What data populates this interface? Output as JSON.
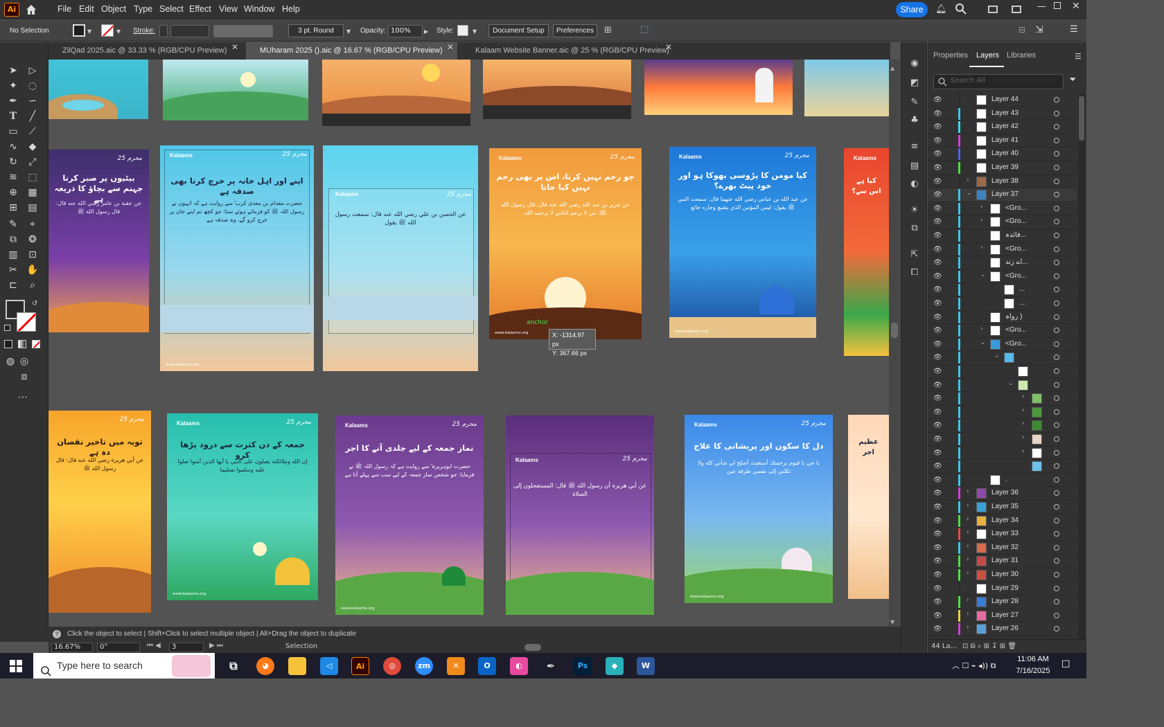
{
  "menubar": {
    "app_logo": "Ai",
    "items": [
      "File",
      "Edit",
      "Object",
      "Type",
      "Select",
      "Effect",
      "View",
      "Window",
      "Help"
    ],
    "share_label": "Share"
  },
  "control_bar": {
    "selection": "No Selection",
    "stroke_label": "Stroke:",
    "brush": "3 pt. Round",
    "opacity_label": "Opacity:",
    "opacity_value": "100%",
    "style_label": "Style:",
    "document_setup": "Document Setup",
    "preferences": "Preferences"
  },
  "tabs": [
    {
      "label": "ZilQad 2025.aic @ 33.33 % (RGB/CPU Preview)"
    },
    {
      "label": "MUharam 2025 ().aic @ 16.67 % (RGB/CPU Preview)"
    },
    {
      "label": "Kalaam Website Banner.aic @ 25 % (RGB/CPU Preview)"
    }
  ],
  "canvas": {
    "tooltip_x": "X: -1314.97 px",
    "tooltip_y": "Y: 367.66 px",
    "anchor_label": "anchor",
    "posters": {
      "brand": "Kalaams",
      "badge": "محرم 25",
      "website": "www.kalaams.org",
      "p_purple_title": "بیٹیوں پر صبر کرنا جہنم سے بچاؤ کا ذریعہ ہے",
      "p_cream_title": "اپنے اور اہل خانہ پر خرچ کرنا بھی صدقہ ہے",
      "p_orange_title": "جو رحم نہیں کرتا، اس پر بھی رحم نہیں کیا جاتا",
      "p_blue_title": "کیا مومن کا پڑوسی بھوکا ہو اور خود پیٹ بھرے؟",
      "p_red_title": "کیا ہے اس سے؟",
      "p_yellow_title": "توبہ میں تاخیر نقصان دہ ہے",
      "p_teal_title": "جمعہ کے دن کثرت سے درود پڑھا کرو",
      "p_purple2_title": "نماز جمعہ کے لیے جلدی آنے کا اجر",
      "p_sky_title": "دل کا سکون اور پریشانی کا علاج",
      "p_peach_title": "عظیم اجر"
    }
  },
  "status": {
    "hint": "Click the object to select  |  Shift+Click to select multiple object  |  Alt+Drag the object to duplicate",
    "zoom": "16.67%",
    "rotation": "0°",
    "artboard": "3",
    "mode": "Selection"
  },
  "panel": {
    "tabs": [
      "Properties",
      "Layers",
      "Libraries"
    ],
    "active_tab": "Layers",
    "search_placeholder": "Search All",
    "layers": [
      {
        "name": "Layer 44",
        "color": "#2b2b2b",
        "thumb": "#ffffff",
        "indent": 0,
        "tri": ""
      },
      {
        "name": "Layer 43",
        "color": "#3ec6e8",
        "thumb": "#ffffff",
        "indent": 0,
        "tri": ""
      },
      {
        "name": "Layer 42",
        "color": "#39d7e8",
        "thumb": "#ffffff",
        "indent": 0,
        "tri": ""
      },
      {
        "name": "Layer 41",
        "color": "#d43ed9",
        "thumb": "#ffffff",
        "indent": 0,
        "tri": ""
      },
      {
        "name": "Layer 40",
        "color": "#4b62e8",
        "thumb": "#ffffff",
        "indent": 0,
        "tri": ""
      },
      {
        "name": "Layer 39",
        "color": "#4ede42",
        "thumb": "#ffffff",
        "indent": 0,
        "tri": ""
      },
      {
        "name": "Layer 38",
        "color": "#2b2b2b",
        "thumb": "#9b6a4a",
        "indent": 0,
        "tri": "›"
      },
      {
        "name": "Layer 37",
        "color": "#3ec6e8",
        "thumb": "#3b82c4",
        "indent": 0,
        "tri": "⌄",
        "sel": true
      },
      {
        "name": "<Gro...",
        "color": "#3ec6e8",
        "thumb": "#ffffff",
        "indent": 1,
        "tri": "›"
      },
      {
        "name": "<Gro...",
        "color": "#3ec6e8",
        "thumb": "#ffffff",
        "indent": 1,
        "tri": "›"
      },
      {
        "name": "فائدہ...",
        "color": "#3ec6e8",
        "thumb": "#ffffff",
        "indent": 1,
        "tri": ""
      },
      {
        "name": "<Gro...",
        "color": "#3ec6e8",
        "thumb": "#ffffff",
        "indent": 1,
        "tri": "›"
      },
      {
        "name": "اے زند...",
        "color": "#3ec6e8",
        "thumb": "#ffffff",
        "indent": 1,
        "tri": ""
      },
      {
        "name": "<Gro...",
        "color": "#3ec6e8",
        "thumb": "#ffffff",
        "indent": 1,
        "tri": "⌄"
      },
      {
        "name": "...",
        "color": "#3ec6e8",
        "thumb": "#ffffff",
        "indent": 2,
        "tri": ""
      },
      {
        "name": "...",
        "color": "#3ec6e8",
        "thumb": "#ffffff",
        "indent": 2,
        "tri": ""
      },
      {
        "name": "رواہ )",
        "color": "#3ec6e8",
        "thumb": "#ffffff",
        "indent": 1,
        "tri": ""
      },
      {
        "name": "<Gro...",
        "color": "#3ec6e8",
        "thumb": "#ffffff",
        "indent": 1,
        "tri": "›"
      },
      {
        "name": "<Gro...",
        "color": "#3ec6e8",
        "thumb": "#3b9ad9",
        "indent": 1,
        "tri": "⌄"
      },
      {
        "name": "",
        "color": "#3ec6e8",
        "thumb": "#5ab8e8",
        "indent": 2,
        "tri": "⌄"
      },
      {
        "name": "",
        "color": "#3ec6e8",
        "thumb": "#ffffff",
        "indent": 3,
        "tri": ""
      },
      {
        "name": "",
        "color": "#3ec6e8",
        "thumb": "#cfe8b0",
        "indent": 3,
        "tri": "⌄"
      },
      {
        "name": "",
        "color": "#3ec6e8",
        "thumb": "#7fbf6a",
        "indent": 4,
        "tri": "›"
      },
      {
        "name": "",
        "color": "#3ec6e8",
        "thumb": "#4c9a3c",
        "indent": 4,
        "tri": "›"
      },
      {
        "name": "",
        "color": "#3ec6e8",
        "thumb": "#3f8a35",
        "indent": 4,
        "tri": "›"
      },
      {
        "name": "",
        "color": "#3ec6e8",
        "thumb": "#e8d4c8",
        "indent": 4,
        "tri": "›"
      },
      {
        "name": "",
        "color": "#3ec6e8",
        "thumb": "#ffffff",
        "indent": 4,
        "tri": "›"
      },
      {
        "name": "",
        "color": "#3ec6e8",
        "thumb": "#6fc0ea",
        "indent": 4,
        "tri": ""
      },
      {
        "name": ".",
        "color": "#3ec6e8",
        "thumb": "#ffffff",
        "indent": 1,
        "tri": ""
      },
      {
        "name": "Layer 36",
        "color": "#d43ed9",
        "thumb": "#8e4aa8",
        "indent": 0,
        "tri": "›"
      },
      {
        "name": "Layer 35",
        "color": "#3ec6e8",
        "thumb": "#3aa0d8",
        "indent": 0,
        "tri": "›"
      },
      {
        "name": "Layer 34",
        "color": "#4ede42",
        "thumb": "#e8b040",
        "indent": 0,
        "tri": "›"
      },
      {
        "name": "Layer 33",
        "color": "#e84b4b",
        "thumb": "#ffffff",
        "indent": 0,
        "tri": "›"
      },
      {
        "name": "Layer 32",
        "color": "#3ec6e8",
        "thumb": "#d66a4a",
        "indent": 0,
        "tri": "›"
      },
      {
        "name": "Layer 31",
        "color": "#4ede42",
        "thumb": "#c44a4a",
        "indent": 0,
        "tri": "›"
      },
      {
        "name": "Layer 30",
        "color": "#4ede42",
        "thumb": "#c85040",
        "indent": 0,
        "tri": "›"
      },
      {
        "name": "Layer 29",
        "color": "#2b2b2b",
        "thumb": "#ffffff",
        "indent": 0,
        "tri": ""
      },
      {
        "name": "Layer 28",
        "color": "#4ede42",
        "thumb": "#3a7bd5",
        "indent": 0,
        "tri": "›"
      },
      {
        "name": "Layer 27",
        "color": "#e8d43e",
        "thumb": "#e86aa0",
        "indent": 0,
        "tri": "›"
      },
      {
        "name": "Layer 26",
        "color": "#d43ed9",
        "thumb": "#5aa0d8",
        "indent": 0,
        "tri": "›"
      }
    ],
    "footer_count": "44 La..."
  },
  "taskbar": {
    "search_placeholder": "Type here to search",
    "time": "11:06 AM",
    "date": "7/16/2025",
    "apps": [
      "task-view",
      "firefox",
      "file-explorer",
      "vscode",
      "illustrator",
      "chrome",
      "zoom",
      "app-orange",
      "outlook",
      "app-pink",
      "pen-app",
      "photoshop",
      "app-teal",
      "word"
    ]
  }
}
